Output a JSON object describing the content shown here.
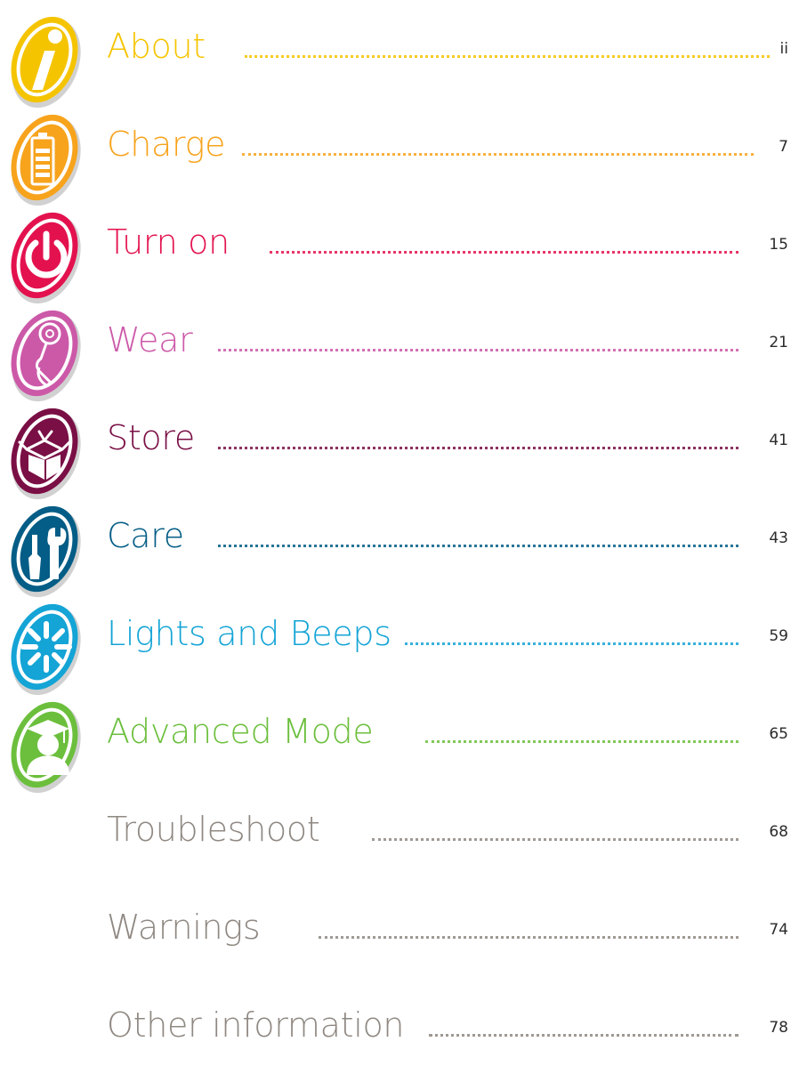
{
  "toc": {
    "entries": [
      {
        "title": "About",
        "page": "ii",
        "color": "#f5c400",
        "icon": "info-icon"
      },
      {
        "title": "Charge",
        "page": "7",
        "color": "#f7a31c",
        "icon": "battery-icon"
      },
      {
        "title": "Turn on",
        "page": "15",
        "color": "#e3124f",
        "icon": "power-icon"
      },
      {
        "title": "Wear",
        "page": "21",
        "color": "#cc59a8",
        "icon": "hearing-aid-icon"
      },
      {
        "title": "Store",
        "page": "41",
        "color": "#7a0f45",
        "icon": "box-icon"
      },
      {
        "title": "Care",
        "page": "43",
        "color": "#045d86",
        "icon": "tools-icon"
      },
      {
        "title": "Lights and Beeps",
        "page": "59",
        "color": "#14a4d6",
        "icon": "light-burst-icon"
      },
      {
        "title": "Advanced Mode",
        "page": "65",
        "color": "#6cbf3d",
        "icon": "graduate-icon"
      },
      {
        "title": "Troubleshoot",
        "page": "68",
        "color": "#8f8882",
        "icon": ""
      },
      {
        "title": "Warnings",
        "page": "74",
        "color": "#8f8882",
        "icon": ""
      },
      {
        "title": "Other information",
        "page": "78",
        "color": "#8f8882",
        "icon": ""
      }
    ]
  }
}
